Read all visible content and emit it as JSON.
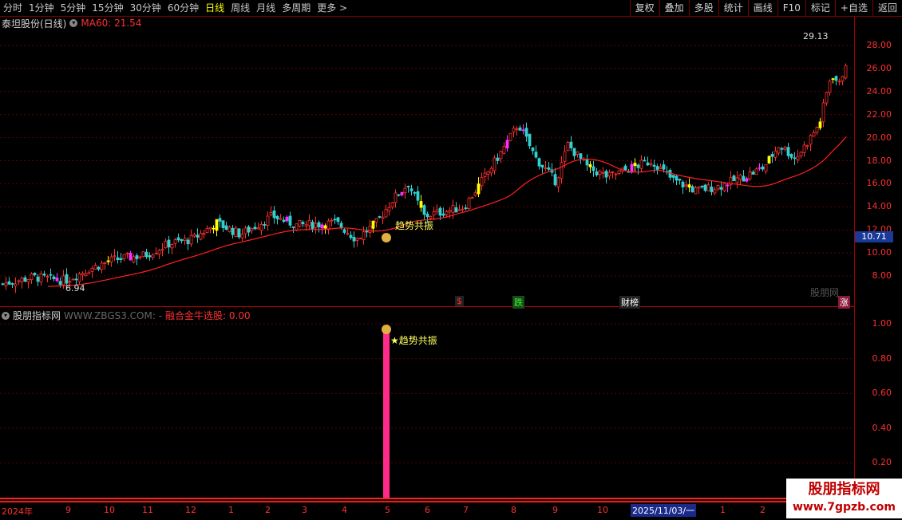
{
  "toolbar": {
    "periods": [
      "分时",
      "1分钟",
      "5分钟",
      "15分钟",
      "30分钟",
      "60分钟",
      "日线",
      "周线",
      "月线",
      "多周期",
      "更多"
    ],
    "active_period": "日线",
    "right_buttons": [
      "复权",
      "叠加",
      "多股",
      "统计",
      "画线",
      "F10",
      "标记",
      "+自选",
      "返回"
    ]
  },
  "stock": {
    "name": "泰坦股份(日线)",
    "ma_label": "MA60: 21.54"
  },
  "price_axis": [
    "28.00",
    "26.00",
    "24.00",
    "22.00",
    "20.00",
    "18.00",
    "16.00",
    "14.00",
    "12.00",
    "10.00",
    "8.00"
  ],
  "current_price": "10.71",
  "high_label": "29.13",
  "low_label": "6.94",
  "signal_label": "趋势共振",
  "event_tags": [
    {
      "text": "$",
      "color": "#ff3030"
    },
    {
      "text": "跌",
      "color": "#30ff30"
    },
    {
      "text": "财榜",
      "color": "#ffffff"
    },
    {
      "text": "涨",
      "color": "#ffffff"
    }
  ],
  "small_watermark": "股朋网",
  "indicator": {
    "name": "股朋指标网",
    "url": "WWW.ZBGS3.COM: -",
    "value_label": "融合金牛选股: 0.00",
    "signal_label": "★趋势共振",
    "axis": [
      "1.00",
      "0.80",
      "0.60",
      "0.40",
      "0.20"
    ]
  },
  "time_axis": [
    "2024年",
    "9",
    "10",
    "11",
    "12",
    "1",
    "2",
    "3",
    "4",
    "5",
    "6",
    "7",
    "8",
    "9",
    "10",
    "1",
    "2"
  ],
  "time_date": "2025/11/03/一",
  "watermark": {
    "line1": "股朋指标网",
    "line2": "www.7gpzb.com"
  },
  "chart_data": {
    "type": "candlestick",
    "ma_period": 60,
    "y_range": [
      6.94,
      29.13
    ],
    "signal_position": "2025-05",
    "indicator_value_at_signal": 0.95
  }
}
